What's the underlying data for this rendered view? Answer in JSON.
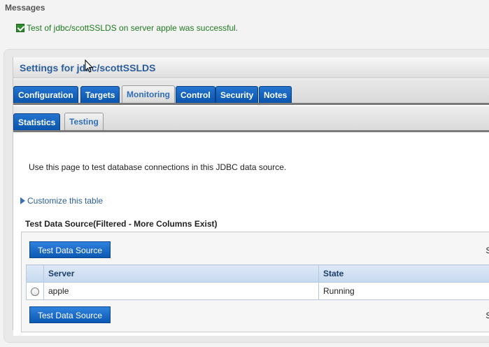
{
  "messages": {
    "title": "Messages",
    "success": "Test of jdbc/scottSSLDS on server apple was successful."
  },
  "settings": {
    "title": "Settings for jdbc/scottSSLDS"
  },
  "tabs": [
    {
      "label": "Configuration",
      "active": false
    },
    {
      "label": "Targets",
      "active": false
    },
    {
      "label": "Monitoring",
      "active": true
    },
    {
      "label": "Control",
      "active": false
    },
    {
      "label": "Security",
      "active": false
    },
    {
      "label": "Notes",
      "active": false
    }
  ],
  "subtabs": [
    {
      "label": "Statistics",
      "active": false
    },
    {
      "label": "Testing",
      "active": true
    }
  ],
  "content": {
    "intro": "Use this page to test database connections in this JDBC data source.",
    "customize": "Customize this table",
    "table_title": "Test Data Source(Filtered - More Columns Exist)",
    "button_label": "Test Data Source",
    "showing_text": "Sh",
    "columns": [
      "Server",
      "State"
    ],
    "rows": [
      {
        "server": "apple",
        "state": "Running"
      }
    ]
  },
  "colors": {
    "accent": "#0a55ad",
    "success": "#1f7a1f",
    "title": "#2a5d9a"
  }
}
